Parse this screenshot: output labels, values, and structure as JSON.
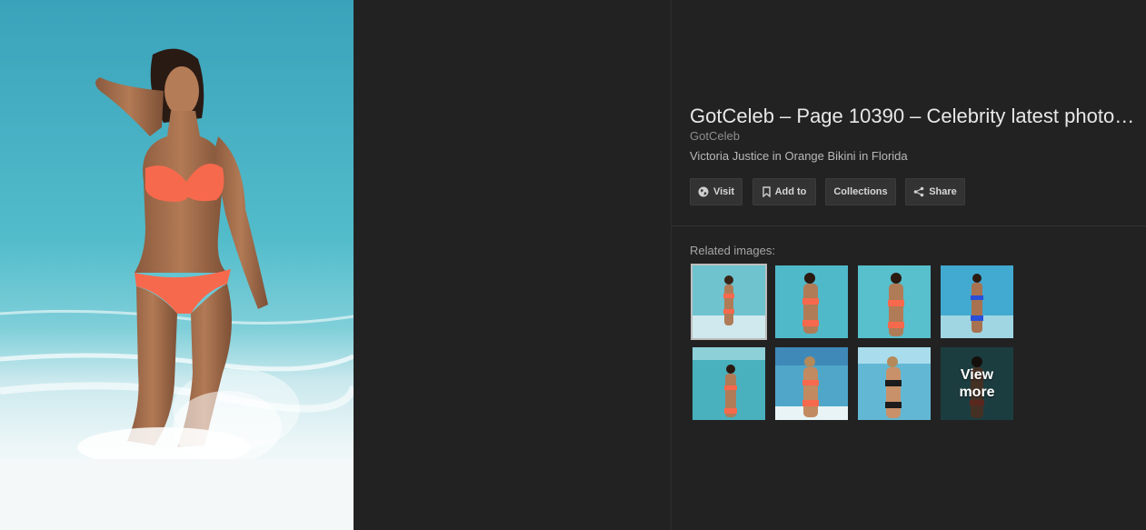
{
  "result": {
    "title": "GotCeleb – Page 10390 – Celebrity latest photo…",
    "source": "GotCeleb",
    "caption": "Victoria Justice in Orange Bikini in Florida"
  },
  "actions": [
    {
      "label": "Visit",
      "icon": "globe-icon"
    },
    {
      "label": "Add to",
      "icon": "bookmark-icon"
    },
    {
      "label": "Collections",
      "icon": ""
    },
    {
      "label": "Share",
      "icon": "share-icon"
    }
  ],
  "related": {
    "label": "Related images:",
    "view_more_line1": "View",
    "view_more_line2": "more"
  },
  "colors": {
    "background": "#222222",
    "button": "#333333",
    "bikini": "#f7694d",
    "sea": "#4cb8c9"
  }
}
